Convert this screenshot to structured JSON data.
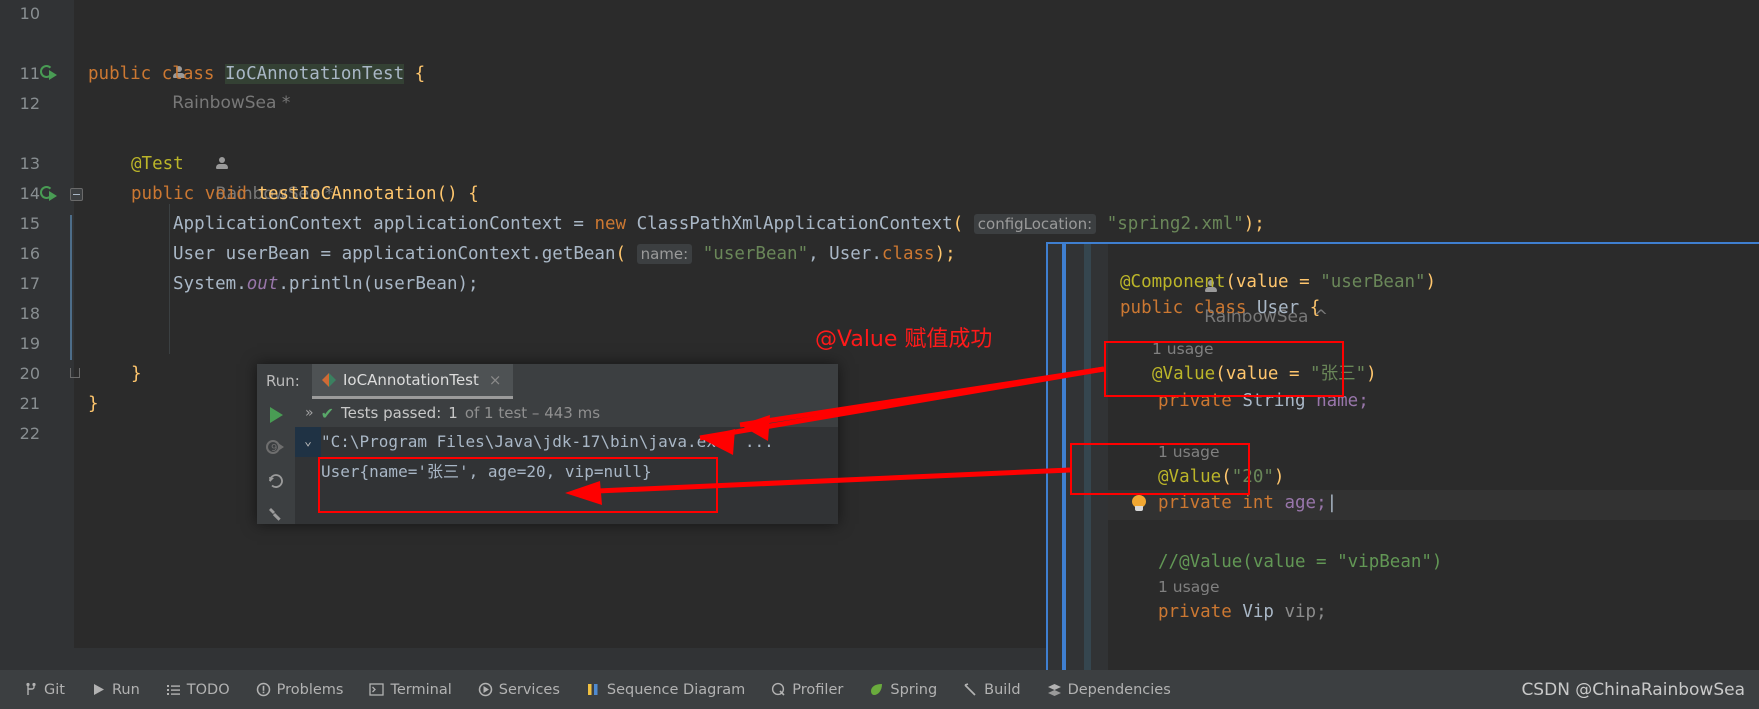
{
  "editor": {
    "gutter_lines": [
      "10",
      "11",
      "12",
      "13",
      "14",
      "15",
      "16",
      "17",
      "18",
      "19",
      "20",
      "21",
      "22"
    ],
    "author_tag_1": "RainbowSea *",
    "author_tag_2": "RainbowSea *",
    "lines": {
      "l11_public": "public",
      "l11_class": "class",
      "l11_name": "IoCAnnotationTest",
      "l11_brace": "{",
      "l13_test": "@Test",
      "l14_public": "public",
      "l14_void": "void",
      "l14_method": "testIoCAnnotation",
      "l14_parens": "()",
      "l14_brace": "{",
      "l15_type": "ApplicationContext applicationContext = ",
      "l15_new": "new",
      "l15_ctor": " ClassPathXmlApplicationContext",
      "l15_openparen": "(",
      "l15_hint": "configLocation:",
      "l15_str": "\"spring2.xml\"",
      "l15_tail": ");",
      "l16_type": "User userBean = applicationContext.getBean",
      "l16_openparen": "(",
      "l16_hint": "name:",
      "l16_str": "\"userBean\"",
      "l16_mid": ", User.",
      "l16_class_kw": "class",
      "l16_tail": ");",
      "l17_sys": "System.",
      "l17_out": "out",
      "l17_println": ".println(userBean);",
      "l20_brace": "}",
      "l21_brace": "}"
    }
  },
  "right_panel": {
    "author_tag": "RainbowSea ^",
    "component_ann": "@Component",
    "component_args_open": "(value = ",
    "component_value": "\"userBean\"",
    "component_args_close": ")",
    "public_kw": "public",
    "class_kw": "class",
    "class_name": "User",
    "class_brace": "{",
    "usage_name": "1 usage",
    "value_name_ann": "@Value",
    "value_name_open": "(value = ",
    "value_name_str": "\"张三\"",
    "value_name_close": ")",
    "private_kw": "private",
    "string_type": "String",
    "name_field": "name;",
    "usage_age": "1 usage",
    "value_age_ann": "@Value",
    "value_age_open": "(",
    "value_age_str": "\"20\"",
    "value_age_close": ")",
    "private_kw2": "private",
    "int_kw": "int",
    "age_field": "age;",
    "vip_comment": "//@Value(value = \"vipBean\")",
    "usage_vip": "1 usage",
    "private_kw3": "private",
    "vip_type": "Vip",
    "vip_field": "vip;"
  },
  "run_window": {
    "run_label": "Run:",
    "tab_name": "IoCAnnotationTest",
    "tab_close": "×",
    "chevron": "»",
    "check": "✔",
    "tests_passed_label": "Tests passed:",
    "tests_passed_count": "1",
    "tests_of": "of 1 test – 443 ms",
    "console_collapse": "⌄",
    "console_line_1": "\"C:\\Program Files\\Java\\jdk-17\\bin\\java.exe\" ...",
    "console_line_2": "User{name='张三', age=20, vip=null}"
  },
  "annotations": {
    "value_success_text": "@Value 赋值成功",
    "color": "#ff0000"
  },
  "statusbar": {
    "items": [
      {
        "label": "Git",
        "icon": "git-branch-icon"
      },
      {
        "label": "Run",
        "icon": "run-play-icon"
      },
      {
        "label": "TODO",
        "icon": "todo-list-icon"
      },
      {
        "label": "Problems",
        "icon": "problems-warning-icon"
      },
      {
        "label": "Terminal",
        "icon": "terminal-icon"
      },
      {
        "label": "Services",
        "icon": "services-icon"
      },
      {
        "label": "Sequence Diagram",
        "icon": "sequence-diagram-icon"
      },
      {
        "label": "Profiler",
        "icon": "profiler-icon"
      },
      {
        "label": "Spring",
        "icon": "spring-leaf-icon"
      },
      {
        "label": "Build",
        "icon": "build-hammer-icon"
      },
      {
        "label": "Dependencies",
        "icon": "dependencies-icon"
      }
    ],
    "watermark": "CSDN @ChinaRainbowSea"
  }
}
